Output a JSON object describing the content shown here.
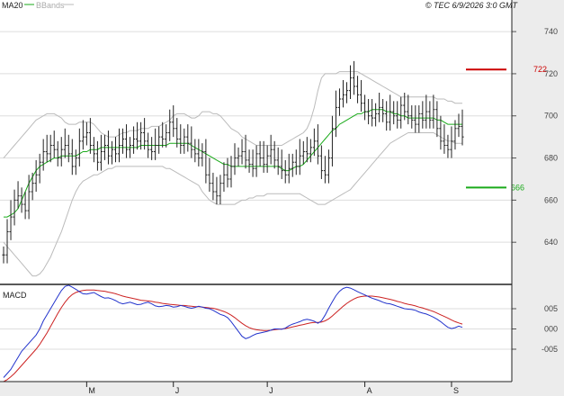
{
  "legend": {
    "ma20_label": "MA20",
    "bbands_label": "BBands",
    "ma20_color": "#1aaa1a",
    "bbands_color": "#bbbbbb"
  },
  "copyright": "© TEC 6/9/2026 3:0 GMT",
  "macd_label": "MACD",
  "colors": {
    "price": "#222222",
    "macd_line": "#2233cc",
    "signal_line": "#cc2222",
    "resistance": "#cc0000",
    "support": "#1aaa1a",
    "grid": "#dddddd",
    "axis_bg": "#ececec"
  },
  "chart_data": {
    "type": "ohlc",
    "price_axis": {
      "ticks": [
        640,
        660,
        680,
        700,
        720,
        740
      ],
      "tick_labels": [
        "640",
        "660",
        "680",
        "700",
        "720",
        "740"
      ],
      "range": [
        620,
        755
      ]
    },
    "macd_axis": {
      "ticks": [
        5,
        0,
        -5
      ],
      "tick_labels": [
        "005",
        "000",
        "-005"
      ],
      "range": [
        -13,
        11
      ]
    },
    "month_labels": [
      {
        "label": "M",
        "index": 23
      },
      {
        "label": "J",
        "index": 47
      },
      {
        "label": "J",
        "index": 73
      },
      {
        "label": "A",
        "index": 100
      },
      {
        "label": "S",
        "index": 124
      }
    ],
    "resistance": {
      "value": 722,
      "label": "722"
    },
    "support": {
      "value": 666,
      "label": "666"
    },
    "closes": [
      634,
      645,
      652,
      660,
      662,
      658,
      655,
      664,
      668,
      672,
      678,
      683,
      682,
      686,
      684,
      680,
      684,
      686,
      682,
      676,
      680,
      688,
      690,
      692,
      686,
      682,
      678,
      683,
      686,
      681,
      684,
      682,
      686,
      689,
      684,
      686,
      689,
      688,
      692,
      688,
      684,
      683,
      686,
      690,
      689,
      692,
      697,
      694,
      689,
      686,
      690,
      687,
      684,
      682,
      680,
      683,
      672,
      668,
      664,
      662,
      668,
      672,
      670,
      676,
      680,
      681,
      683,
      679,
      677,
      675,
      682,
      680,
      677,
      681,
      684,
      679,
      676,
      674,
      672,
      675,
      678,
      676,
      681,
      683,
      682,
      685,
      688,
      681,
      674,
      672,
      680,
      694,
      704,
      708,
      710,
      712,
      718,
      714,
      710,
      706,
      702,
      700,
      699,
      701,
      704,
      701,
      697,
      702,
      700,
      698,
      705,
      702,
      700,
      698,
      696,
      701,
      698,
      702,
      698,
      703,
      694,
      688,
      686,
      684,
      688,
      694,
      695,
      690
    ],
    "ma20": [
      652,
      652,
      653,
      654,
      656,
      660,
      664,
      668,
      671,
      674,
      676,
      677,
      678,
      679,
      680,
      680,
      681,
      681,
      681,
      681,
      681,
      682,
      683,
      683,
      684,
      684,
      684,
      685,
      685,
      685,
      685,
      685,
      685,
      685,
      685,
      685,
      685,
      685,
      686,
      686,
      686,
      686,
      686,
      686,
      686,
      686,
      687,
      687,
      687,
      687,
      687,
      687,
      686,
      685,
      684,
      683,
      682,
      681,
      680,
      679,
      678,
      677,
      677,
      676,
      676,
      676,
      676,
      676,
      676,
      676,
      676,
      676,
      676,
      676,
      676,
      676,
      676,
      675,
      674,
      674,
      675,
      676,
      676,
      677,
      679,
      681,
      683,
      685,
      687,
      689,
      691,
      693,
      694,
      696,
      697,
      698,
      699,
      700,
      701,
      701,
      702,
      702,
      703,
      703,
      703,
      703,
      702,
      702,
      701,
      701,
      700,
      700,
      699,
      699,
      699,
      699,
      699,
      699,
      699,
      699,
      698,
      698,
      697,
      696,
      696,
      696,
      696,
      696
    ],
    "bb_upper": [
      680,
      682,
      684,
      686,
      688,
      690,
      692,
      694,
      696,
      698,
      699,
      700,
      701,
      701,
      701,
      700,
      699,
      697,
      696,
      696,
      696,
      697,
      697,
      697,
      697,
      696,
      694,
      692,
      691,
      690,
      690,
      690,
      691,
      692,
      692,
      693,
      693,
      693,
      694,
      694,
      694,
      695,
      695,
      695,
      696,
      697,
      698,
      700,
      701,
      701,
      701,
      700,
      699,
      699,
      700,
      702,
      702,
      702,
      701,
      701,
      700,
      698,
      696,
      694,
      693,
      692,
      690,
      689,
      688,
      687,
      686,
      686,
      686,
      686,
      686,
      686,
      686,
      686,
      687,
      688,
      689,
      690,
      691,
      692,
      694,
      698,
      704,
      712,
      718,
      720,
      720,
      720,
      720,
      721,
      721,
      721,
      721,
      721,
      721,
      720,
      719,
      718,
      717,
      716,
      715,
      714,
      713,
      712,
      711,
      710,
      709,
      709,
      709,
      709,
      709,
      709,
      709,
      709,
      709,
      709,
      708,
      708,
      708,
      707,
      707,
      706,
      706,
      706
    ],
    "bb_lower": [
      640,
      638,
      636,
      634,
      632,
      630,
      628,
      626,
      624,
      624,
      625,
      627,
      630,
      633,
      637,
      641,
      645,
      650,
      655,
      660,
      664,
      667,
      669,
      670,
      671,
      672,
      672,
      673,
      674,
      675,
      675,
      676,
      676,
      676,
      676,
      676,
      676,
      676,
      676,
      676,
      676,
      676,
      676,
      676,
      676,
      675,
      675,
      674,
      673,
      672,
      671,
      670,
      669,
      668,
      667,
      664,
      662,
      660,
      659,
      658,
      658,
      658,
      658,
      658,
      658,
      659,
      660,
      660,
      661,
      661,
      662,
      662,
      662,
      663,
      663,
      663,
      663,
      663,
      663,
      663,
      663,
      663,
      663,
      662,
      661,
      660,
      659,
      658,
      658,
      658,
      659,
      660,
      661,
      662,
      663,
      664,
      665,
      667,
      669,
      671,
      673,
      675,
      677,
      679,
      681,
      683,
      685,
      687,
      688,
      689,
      690,
      691,
      692,
      692,
      692,
      692,
      692,
      692,
      692,
      692,
      691,
      690,
      689,
      688,
      688,
      687,
      687,
      687
    ],
    "macd": [
      -12,
      -11,
      -10,
      -8.5,
      -7,
      -5.5,
      -4.5,
      -3.5,
      -2.5,
      -1.5,
      0,
      2,
      3.5,
      5,
      6.5,
      8,
      9.5,
      10.5,
      10.8,
      10.3,
      9.8,
      9.2,
      8.7,
      8.6,
      8.8,
      9,
      8.5,
      8,
      7.6,
      7.7,
      7.4,
      7,
      6.5,
      6.2,
      6.4,
      6.6,
      6.3,
      6,
      6.1,
      6.4,
      6.6,
      6.2,
      5.7,
      5.5,
      5.6,
      5.8,
      5.7,
      5.4,
      5.5,
      5.8,
      5.6,
      5.3,
      5.1,
      5.3,
      5.6,
      5.4,
      5.1,
      5,
      4.6,
      4.1,
      3.6,
      3.3,
      2.8,
      1.8,
      0.6,
      -0.6,
      -1.8,
      -2.4,
      -2.1,
      -1.6,
      -1.2,
      -1,
      -0.8,
      -0.6,
      -0.3,
      0,
      0,
      -0.1,
      0.2,
      0.8,
      1.2,
      1.5,
      1.8,
      2.2,
      2.4,
      2.2,
      1.9,
      1.4,
      2,
      3.4,
      5.1,
      6.7,
      8.2,
      9.3,
      10,
      10.3,
      10.1,
      9.7,
      9.2,
      8.8,
      8.4,
      8,
      7.6,
      7.3,
      7,
      6.6,
      6.3,
      6.2,
      5.9,
      5.6,
      5.3,
      5,
      4.9,
      4.8,
      4.6,
      4.2,
      3.9,
      3.7,
      3.3,
      2.9,
      2.4,
      1.8,
      1.1,
      0.4,
      0.1,
      0.3,
      0.7,
      0.4
    ],
    "signal": [
      -13,
      -12.5,
      -11.8,
      -11,
      -10,
      -9,
      -8,
      -7,
      -6,
      -5,
      -3.8,
      -2.4,
      -1,
      0.6,
      2.2,
      3.8,
      5.3,
      6.6,
      7.7,
      8.5,
      9,
      9.3,
      9.5,
      9.6,
      9.6,
      9.6,
      9.5,
      9.4,
      9.3,
      9.1,
      8.9,
      8.7,
      8.4,
      8.1,
      7.9,
      7.7,
      7.5,
      7.3,
      7.1,
      7,
      6.9,
      6.8,
      6.6,
      6.5,
      6.3,
      6.2,
      6.1,
      6,
      5.9,
      5.8,
      5.8,
      5.7,
      5.6,
      5.5,
      5.5,
      5.4,
      5.3,
      5.2,
      5.1,
      4.9,
      4.6,
      4.3,
      3.9,
      3.4,
      2.8,
      2.1,
      1.4,
      0.8,
      0.3,
      0,
      -0.2,
      -0.3,
      -0.4,
      -0.4,
      -0.3,
      -0.2,
      -0.1,
      0,
      0.1,
      0.3,
      0.5,
      0.7,
      0.9,
      1.1,
      1.3,
      1.5,
      1.6,
      1.6,
      1.7,
      2,
      2.5,
      3.2,
      4,
      4.8,
      5.6,
      6.3,
      6.9,
      7.4,
      7.8,
      8,
      8.1,
      8.1,
      8.1,
      8,
      7.9,
      7.7,
      7.5,
      7.3,
      7.1,
      6.8,
      6.6,
      6.3,
      6.1,
      5.9,
      5.7,
      5.4,
      5.2,
      4.9,
      4.6,
      4.3,
      3.9,
      3.5,
      3.1,
      2.7,
      2.2,
      1.8,
      1.5,
      1.2
    ]
  }
}
